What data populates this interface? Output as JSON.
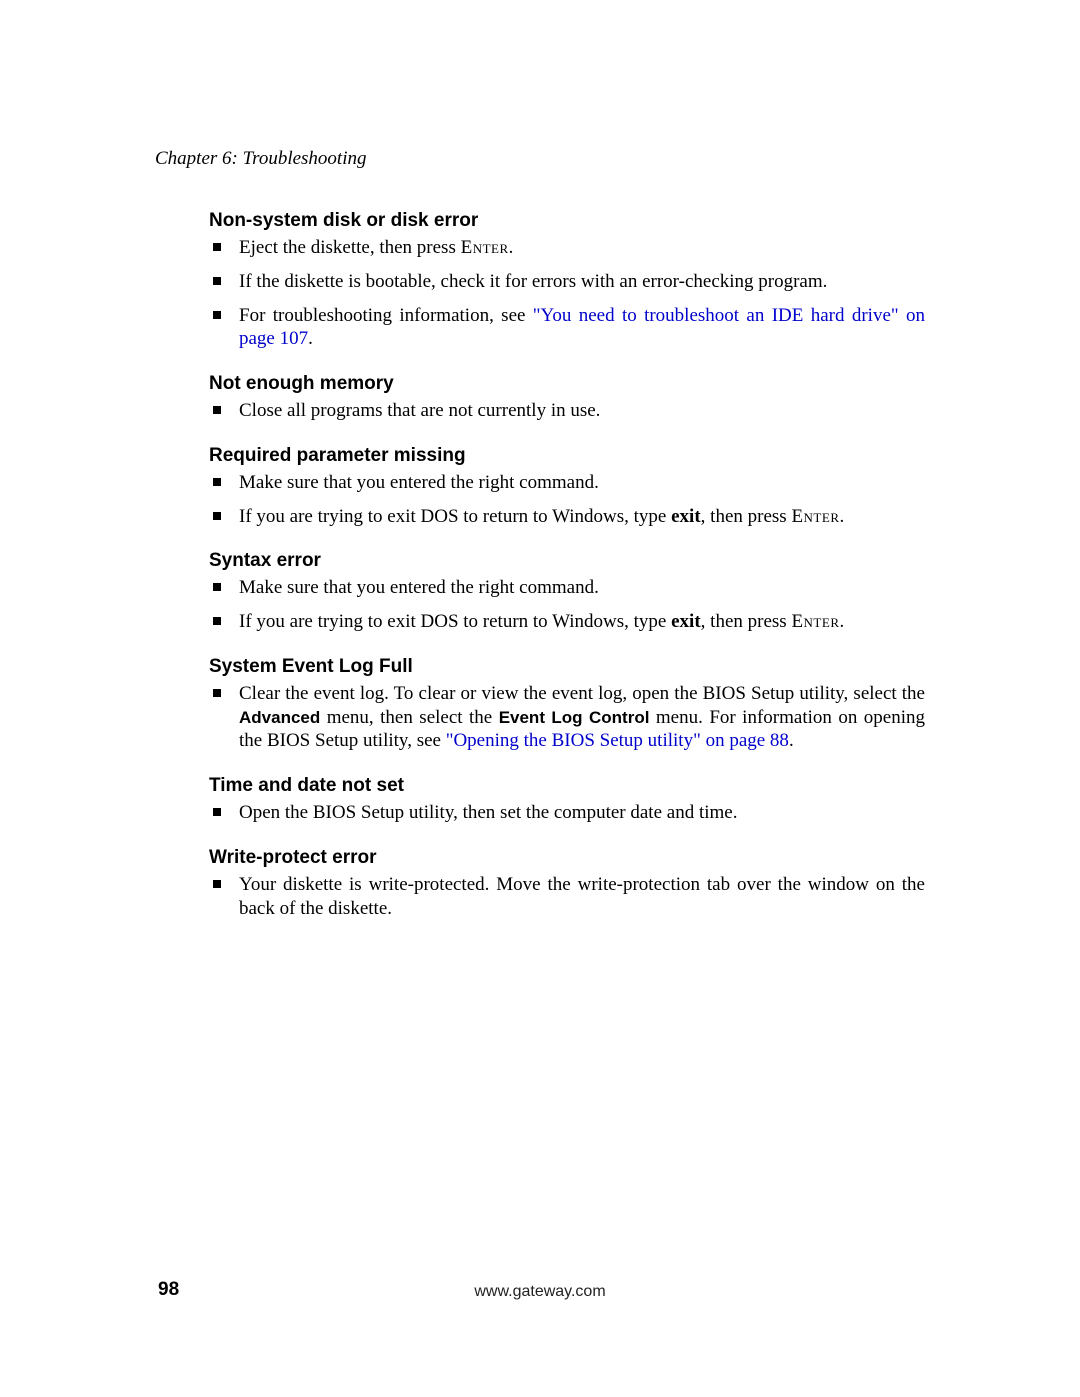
{
  "header": {
    "chapter": "Chapter 6: Troubleshooting"
  },
  "footer": {
    "url": "www.gateway.com",
    "page": "98"
  },
  "sections": {
    "s1": {
      "title": "Non-system disk or disk error",
      "b1a": "Eject the diskette, then press ",
      "b1b": "Enter",
      "b1c": ".",
      "b2": "If the diskette is bootable, check it for errors with an error-checking program.",
      "b3a": "For troubleshooting information, see ",
      "b3b": "\"You need to troubleshoot an IDE hard drive\" on page 107",
      "b3c": "."
    },
    "s2": {
      "title": "Not enough memory",
      "b1": "Close all programs that are not currently in use."
    },
    "s3": {
      "title": "Required parameter missing",
      "b1": "Make sure that you entered the right command.",
      "b2a": "If you are trying to exit DOS to return to Windows, type ",
      "b2b": "exit",
      "b2c": ", then press ",
      "b2d": "Enter",
      "b2e": "."
    },
    "s4": {
      "title": "Syntax error",
      "b1": "Make sure that you entered the right command.",
      "b2a": "If you are trying to exit DOS to return to Windows, type ",
      "b2b": "exit",
      "b2c": ", then press ",
      "b2d": "Enter",
      "b2e": "."
    },
    "s5": {
      "title": "System Event Log Full",
      "b1a": "Clear the event log. To clear or view the event log, open the BIOS Setup utility, select the ",
      "b1b": "Advanced",
      "b1c": " menu, then select the ",
      "b1d": "Event Log Control",
      "b1e": " menu. For information on opening the BIOS Setup utility, see ",
      "b1f": "\"Opening the BIOS Setup utility\" on page 88",
      "b1g": "."
    },
    "s6": {
      "title": "Time and date not set",
      "b1": "Open the BIOS Setup utility, then set the computer date and time."
    },
    "s7": {
      "title": "Write-protect error",
      "b1": "Your diskette is write-protected. Move the write-protection tab over the window on the back of the diskette."
    }
  }
}
